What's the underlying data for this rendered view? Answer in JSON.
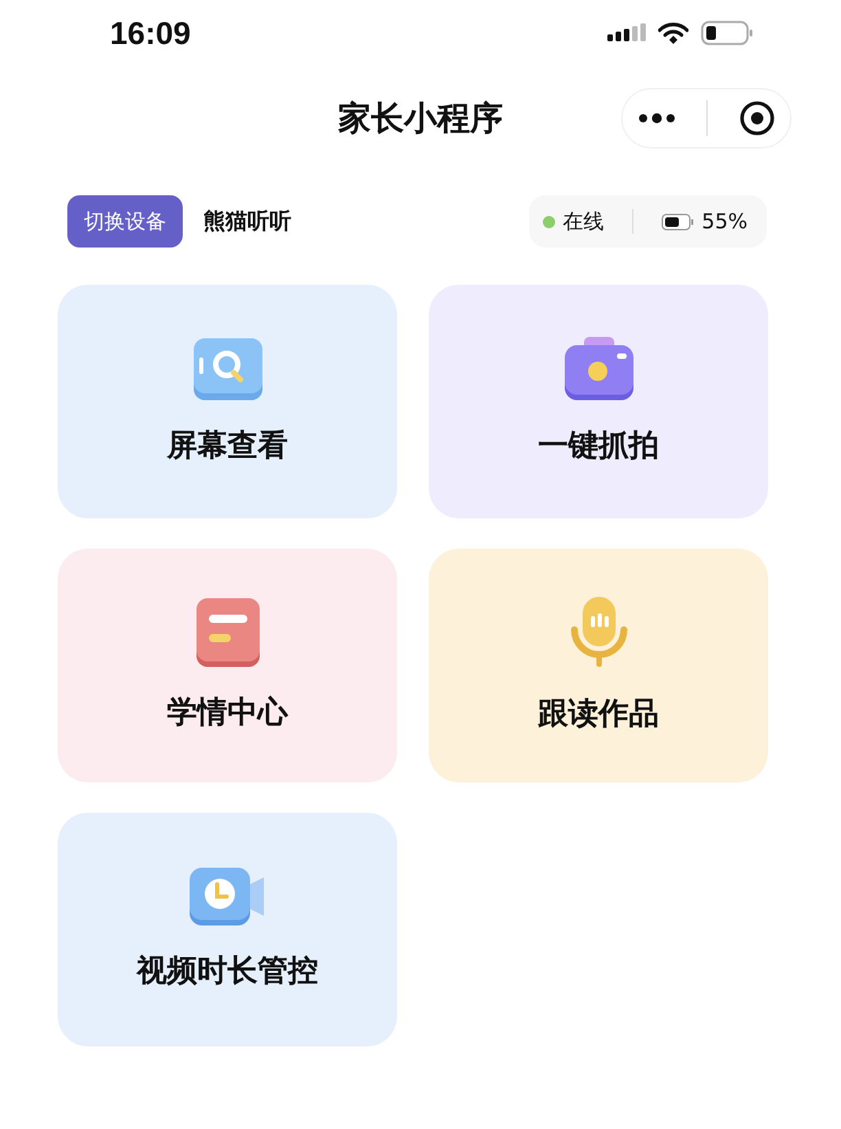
{
  "status_bar": {
    "time": "16:09"
  },
  "nav": {
    "title": "家长小程序"
  },
  "device": {
    "switch_button": "切换设备",
    "name": "熊猫听听",
    "online": true,
    "status": "在线",
    "battery": "55%"
  },
  "tiles": [
    {
      "label": "屏幕查看",
      "kind": "screen",
      "color": "#e6f0fd"
    },
    {
      "label": "一键抓拍",
      "kind": "camera",
      "color": "#efecfd"
    },
    {
      "label": "学情中心",
      "kind": "report",
      "color": "#fcecf0"
    },
    {
      "label": "跟读作品",
      "kind": "mic",
      "color": "#fdf1d9"
    },
    {
      "label": "视频时长管控",
      "kind": "video",
      "color": "#e6f0fd"
    }
  ]
}
